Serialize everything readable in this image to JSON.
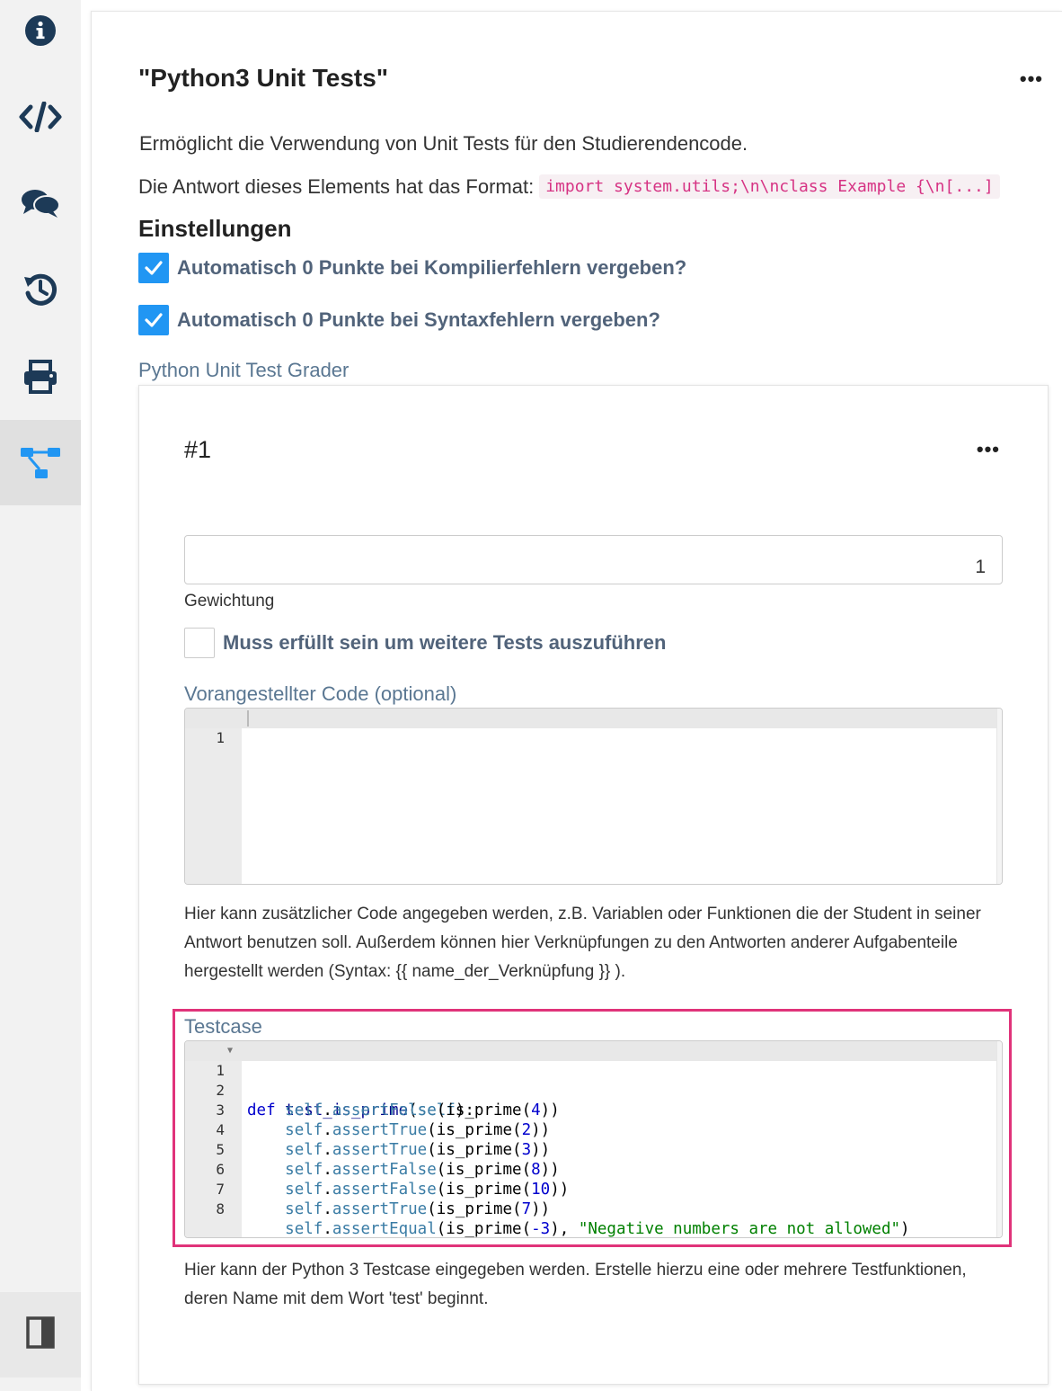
{
  "sidebar": {
    "items": [
      {
        "icon": "info-icon",
        "active": false
      },
      {
        "icon": "code-icon",
        "active": false
      },
      {
        "icon": "comments-icon",
        "active": false
      },
      {
        "icon": "history-icon",
        "active": false
      },
      {
        "icon": "print-icon",
        "active": false
      },
      {
        "icon": "sitemap-icon",
        "active": true
      }
    ],
    "bottom_icon": "panel-toggle-icon"
  },
  "header": {
    "title": "\"Python3 Unit Tests\"",
    "menu_label": "•••"
  },
  "description": "Ermöglicht die Verwendung von Unit Tests für den Studierendencode.",
  "format": {
    "label": "Die Antwort dieses Elements hat das Format:",
    "code": "import system.utils;\\n\\nclass Example {\\n[...]"
  },
  "settings": {
    "heading": "Einstellungen",
    "options": [
      {
        "label": "Automatisch 0 Punkte bei Kompilierfehlern vergeben?",
        "checked": true
      },
      {
        "label": "Automatisch 0 Punkte bei Syntaxfehlern vergeben?",
        "checked": true
      }
    ]
  },
  "grader": {
    "label": "Python Unit Test Grader",
    "card": {
      "title": "#1",
      "menu_label": "•••",
      "weight_value": "1",
      "weight_label": "Gewichtung",
      "must_pass_label": "Muss erfüllt sein um weitere Tests auszuführen",
      "must_pass_checked": false,
      "prefix_code_label": "Vorangestellter Code (optional)",
      "prefix_code_line_numbers": [
        "1"
      ],
      "prefix_code_help": "Hier kann zusätzlicher Code angegeben werden, z.B. Variablen oder Funktionen die der Student in seiner Antwort benutzen soll. Außerdem können hier Verknüpfungen zu den Antworten anderer Aufgabenteile hergestellt werden (Syntax: {{ name_der_Verknüpfung }} ).",
      "testcase_label": "Testcase",
      "testcase_line_numbers": [
        "1",
        "2",
        "3",
        "4",
        "5",
        "6",
        "7",
        "8"
      ],
      "testcase_lines": [
        "def test_is_prime(self):",
        "    self.assertFalse(is_prime(4))",
        "    self.assertTrue(is_prime(2))",
        "    self.assertTrue(is_prime(3))",
        "    self.assertFalse(is_prime(8))",
        "    self.assertFalse(is_prime(10))",
        "    self.assertTrue(is_prime(7))",
        "    self.assertEqual(is_prime(-3), \"Negative numbers are not allowed\")"
      ],
      "testcase_help": "Hier kann der Python 3 Testcase eingegeben werden. Erstelle hierzu eine oder mehrere Testfunktionen, deren Name mit dem Wort 'test' beginnt."
    }
  },
  "colors": {
    "accent": "#2196f3",
    "label": "#5a7792",
    "highlight": "#e0337a",
    "code_inline": "#d63384"
  }
}
